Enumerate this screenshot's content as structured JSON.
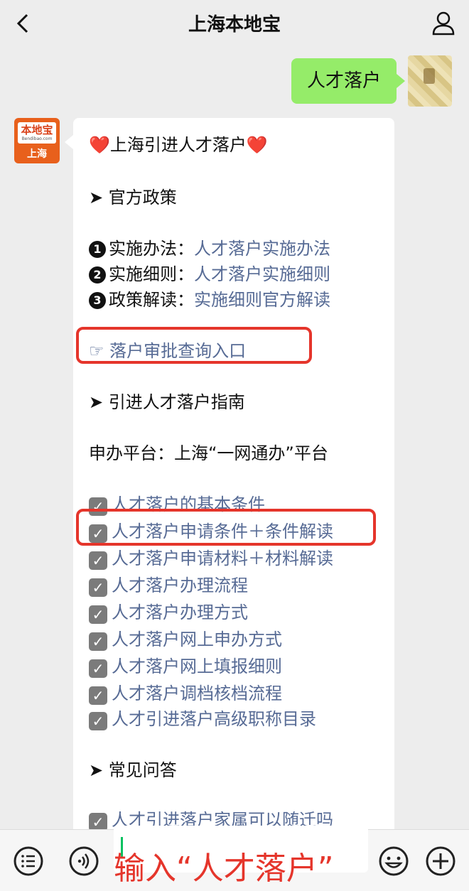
{
  "header": {
    "title": "上海本地宝"
  },
  "messages": {
    "outgoing_text": "人才落户",
    "bot_avatar": {
      "logo_text": "本地宝",
      "logo_sub": "Bendibao.com",
      "city": "上海"
    },
    "card": {
      "title": "❤️上海引进人才落户❤️",
      "section_policy": "➤ 官方政策",
      "policy_items": [
        {
          "num": "1",
          "label": "实施办法：",
          "link": "人才落户实施办法"
        },
        {
          "num": "2",
          "label": "实施细则：",
          "link": "人才落户实施细则"
        },
        {
          "num": "3",
          "label": "政策解读：",
          "link": "实施细则官方解读"
        }
      ],
      "query_entry": "☞ 落户审批查询入口",
      "section_guide": "➤ 引进人才落户指南",
      "platform": "申办平台：上海“一网通办”平台",
      "guide_items": [
        "人才落户的基本条件",
        "人才落户申请条件＋条件解读",
        "人才落户申请材料＋材料解读",
        "人才落户办理流程",
        "人才落户办理方式",
        "人才落户网上申办方式",
        "人才落户网上填报细则",
        "人才落户调档核档流程",
        "人才引进落户高级职称目录"
      ],
      "section_faq": "➤ 常见问答",
      "faq_partial": "人才引进落户家属可以随迁吗"
    }
  },
  "input": {
    "overlay_text": "输入“人才落户”"
  },
  "colors": {
    "link": "#576b95",
    "highlight": "#e5352b",
    "outgoing_bubble": "#95ec69"
  }
}
